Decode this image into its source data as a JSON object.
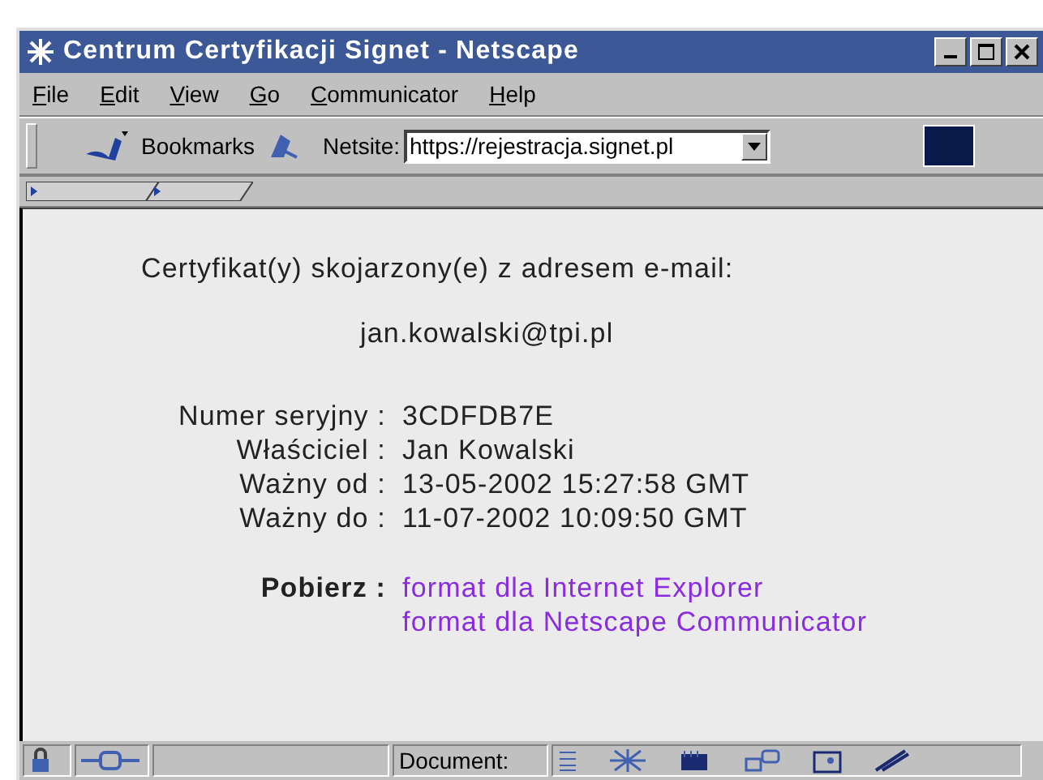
{
  "window": {
    "title": "Centrum Certyfikacji Signet - Netscape"
  },
  "menu": [
    {
      "label": "File"
    },
    {
      "label": "Edit"
    },
    {
      "label": "View"
    },
    {
      "label": "Go"
    },
    {
      "label": "Communicator"
    },
    {
      "label": "Help"
    }
  ],
  "toolbar": {
    "bookmarks": "Bookmarks",
    "netsite_label": "Netsite:",
    "url": "https://rejestracja.signet.pl"
  },
  "content": {
    "heading": "Certyfikat(y) skojarzony(e) z adresem e-mail:",
    "email": "jan.kowalski@tpi.pl",
    "fields": [
      {
        "label": "Numer seryjny :",
        "value": "3CDFDB7E"
      },
      {
        "label": "Właściciel :",
        "value": "Jan Kowalski"
      },
      {
        "label": "Ważny od :",
        "value": "13-05-2002 15:27:58 GMT"
      },
      {
        "label": "Ważny do :",
        "value": "11-07-2002 10:09:50 GMT"
      }
    ],
    "download_label": "Pobierz :",
    "links": [
      "format dla Internet Explorer",
      "format dla Netscape Communicator"
    ]
  },
  "status_bar": {
    "document_label": "Document:"
  }
}
